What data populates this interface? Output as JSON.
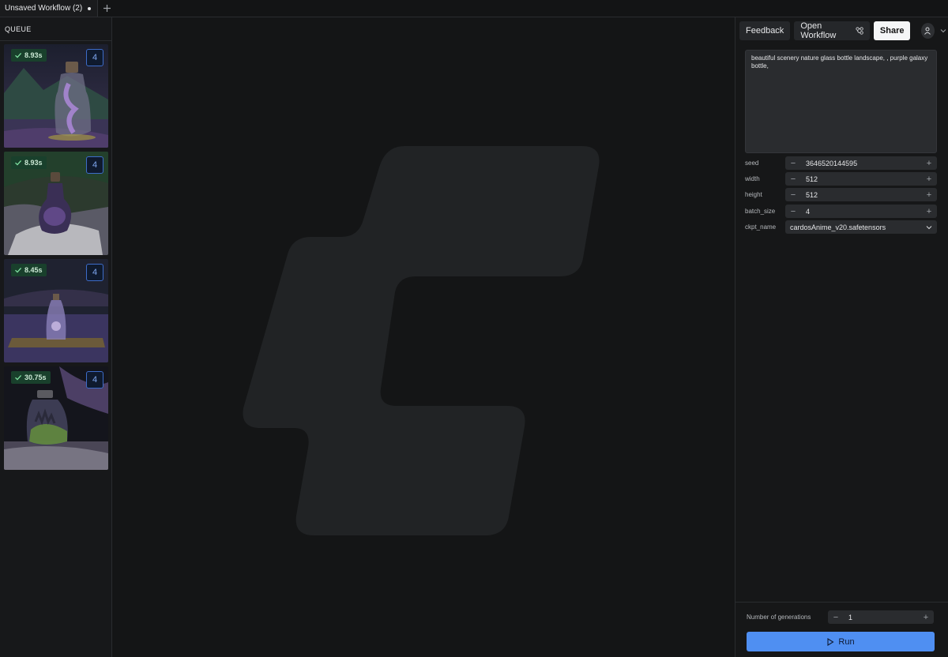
{
  "tabs": [
    {
      "label": "Unsaved Workflow (2)",
      "unsaved": true
    }
  ],
  "queue": {
    "title": "QUEUE",
    "items": [
      {
        "time": "8.93s",
        "count": "4"
      },
      {
        "time": "8.93s",
        "count": "4"
      },
      {
        "time": "8.45s",
        "count": "4"
      },
      {
        "time": "30.75s",
        "count": "4"
      }
    ]
  },
  "toolbar": {
    "feedback": "Feedback",
    "open_workflow": "Open Workflow",
    "share": "Share"
  },
  "prompt": "beautiful scenery nature glass bottle landscape, , purple galaxy bottle,",
  "params": [
    {
      "label": "seed",
      "value": "3646520144595"
    },
    {
      "label": "width",
      "value": "512"
    },
    {
      "label": "height",
      "value": "512"
    },
    {
      "label": "batch_size",
      "value": "4"
    }
  ],
  "ckpt": {
    "label": "ckpt_name",
    "value": "cardosAnime_v20.safetensors"
  },
  "generations": {
    "label": "Number of generations",
    "value": "1"
  },
  "run_label": "Run",
  "colors": {
    "accent": "#4f8ff2",
    "success": "#19402c",
    "background": "#151617"
  }
}
